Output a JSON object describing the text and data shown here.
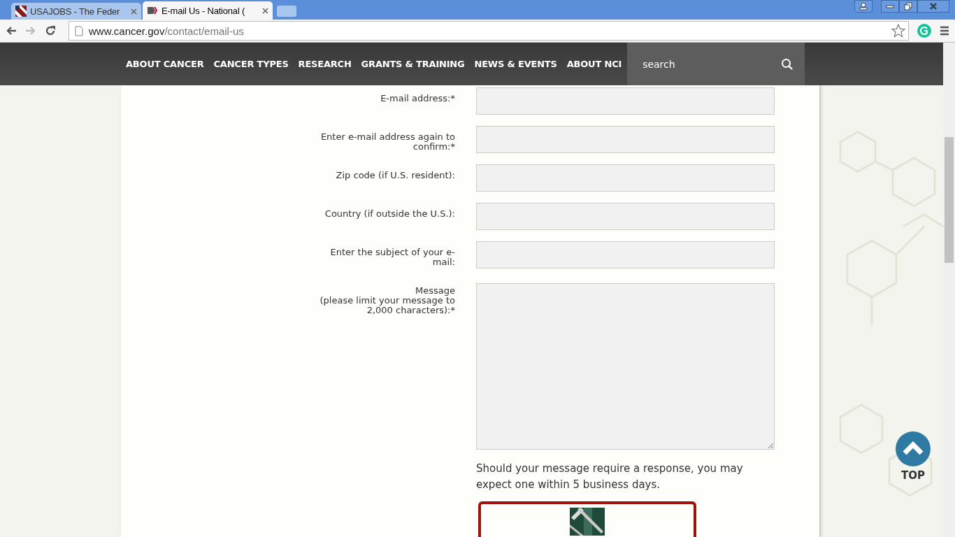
{
  "browser": {
    "tabs": [
      {
        "title": "USAJOBS - The Feder",
        "selected": false
      },
      {
        "title": "E-mail Us - National (",
        "selected": true
      }
    ],
    "url_host": "www.cancer.gov",
    "url_path": "/contact/email-us"
  },
  "nav": {
    "items": [
      "ABOUT CANCER",
      "CANCER TYPES",
      "RESEARCH",
      "GRANTS & TRAINING",
      "NEWS & EVENTS",
      "ABOUT NCI"
    ],
    "search": {
      "placeholder": "search"
    }
  },
  "form": {
    "fields": [
      {
        "label": "E-mail address:*",
        "kind": "text"
      },
      {
        "label": "Enter e-mail address again to confirm:*",
        "kind": "text"
      },
      {
        "label": "Zip code (if U.S. resident):",
        "kind": "text"
      },
      {
        "label": "Country (if outside the U.S.):",
        "kind": "text"
      },
      {
        "label": "Enter the subject of your e-mail:",
        "kind": "text"
      },
      {
        "label": "Message\n(please limit your message to 2,000 characters):*",
        "kind": "textarea"
      }
    ],
    "note": "Should your message require a response, you may expect one within 5 business days."
  },
  "top_button": {
    "label": "TOP"
  }
}
